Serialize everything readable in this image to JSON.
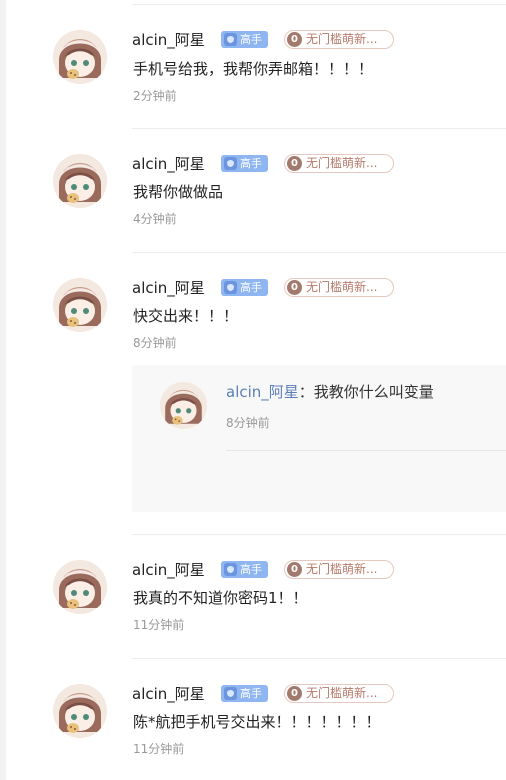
{
  "comments": [
    {
      "username": "alcin_阿星",
      "badge": "高手",
      "fan_level": "0",
      "fan_label": "无门槛萌新...",
      "text": "手机号给我，我帮你弄邮箱！！！！",
      "time": "2分钟前"
    },
    {
      "username": "alcin_阿星",
      "badge": "高手",
      "fan_level": "0",
      "fan_label": "无门槛萌新...",
      "text": "我帮你做做品",
      "time": "4分钟前"
    },
    {
      "username": "alcin_阿星",
      "badge": "高手",
      "fan_level": "0",
      "fan_label": "无门槛萌新...",
      "text": "快交出来！！！",
      "time": "8分钟前"
    },
    {
      "username": "alcin_阿星",
      "badge": "高手",
      "fan_level": "0",
      "fan_label": "无门槛萌新...",
      "text": "我真的不知道你密码1！！",
      "time": "11分钟前"
    },
    {
      "username": "alcin_阿星",
      "badge": "高手",
      "fan_level": "0",
      "fan_label": "无门槛萌新...",
      "text": "陈*航把手机号交出来！！！！！！！",
      "time": "11分钟前"
    }
  ],
  "reply": {
    "username": "alcin_阿星",
    "separator": "：",
    "text": "我教你什么叫变量",
    "time": "8分钟前"
  },
  "colors": {
    "badge_blue": "#8fb6f1",
    "fan_border": "#e5c9bf",
    "reply_name": "#5b7fb8",
    "time_gray": "#999999"
  }
}
